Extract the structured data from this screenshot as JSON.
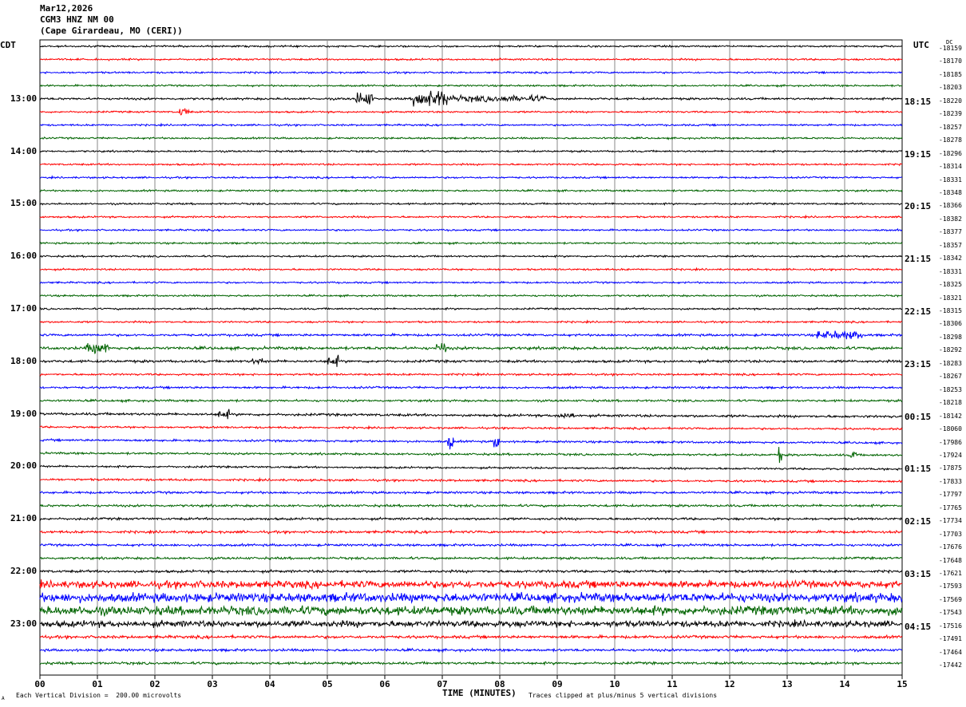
{
  "header": {
    "date": "Mar12,2026",
    "station": "CGM3 HNZ NM 00",
    "location": "(Cape Girardeau, MO (CERI))"
  },
  "left_axis_label": "CDT",
  "right_axis_label": "UTC",
  "dc_label": "DC",
  "chart_data": {
    "type": "line",
    "title": "",
    "xlabel": "TIME (MINUTES)",
    "ylabel": "",
    "xlim": [
      0,
      15
    ],
    "x_ticks": [
      "00",
      "01",
      "02",
      "03",
      "04",
      "05",
      "06",
      "07",
      "08",
      "09",
      "10",
      "11",
      "12",
      "13",
      "14",
      "15"
    ],
    "grid": "vertical lines every minute",
    "trace_colors": [
      "#000000",
      "#ff0000",
      "#0000ff",
      "#006400"
    ],
    "rows_per_hour": 4,
    "row_count": 48,
    "left_hour_labels": [
      "13:00",
      "14:00",
      "15:00",
      "16:00",
      "17:00",
      "18:00",
      "19:00",
      "20:00",
      "21:00",
      "22:00",
      "23:00"
    ],
    "right_hour_labels": [
      "18:15",
      "19:15",
      "20:15",
      "21:15",
      "22:15",
      "23:15",
      "00:15",
      "01:15",
      "02:15",
      "03:15",
      "04:15"
    ],
    "dc_offsets": [
      "-18159",
      "-18170",
      "-18185",
      "-18203",
      "-18220",
      "-18239",
      "-18257",
      "-18278",
      "-18296",
      "-18314",
      "-18331",
      "-18348",
      "-18366",
      "-18382",
      "-18377",
      "-18357",
      "-18342",
      "-18331",
      "-18325",
      "-18321",
      "-18315",
      "-18306",
      "-18298",
      "-18292",
      "-18283",
      "-18267",
      "-18253",
      "-18218",
      "-18142",
      "-18060",
      "-17986",
      "-17924",
      "-17875",
      "-17833",
      "-17797",
      "-17765",
      "-17734",
      "-17703",
      "-17676",
      "-17648",
      "-17621",
      "-17593",
      "-17569",
      "-17543",
      "-17516",
      "-17491",
      "-17464",
      "-17442"
    ],
    "noise_level": [
      1,
      1,
      1,
      1,
      1.2,
      1,
      1,
      1,
      1,
      1,
      1,
      1,
      1,
      1,
      1,
      1,
      1,
      1,
      1,
      1,
      1,
      1,
      1.3,
      1.6,
      1.4,
      1.1,
      1.2,
      1.2,
      1.4,
      1.1,
      1.2,
      1.2,
      1.1,
      1.2,
      1.3,
      1.3,
      1.3,
      1.4,
      1.3,
      1.3,
      1.4,
      4,
      5,
      5,
      3.5,
      1.6,
      1.4,
      1.4
    ]
  },
  "footer": {
    "scale_note": "Each Vertical Division =  200.00 microvolts",
    "clip_note": "Traces clipped at plus/minus 5 vertical divisions",
    "corner_mark": "A"
  }
}
